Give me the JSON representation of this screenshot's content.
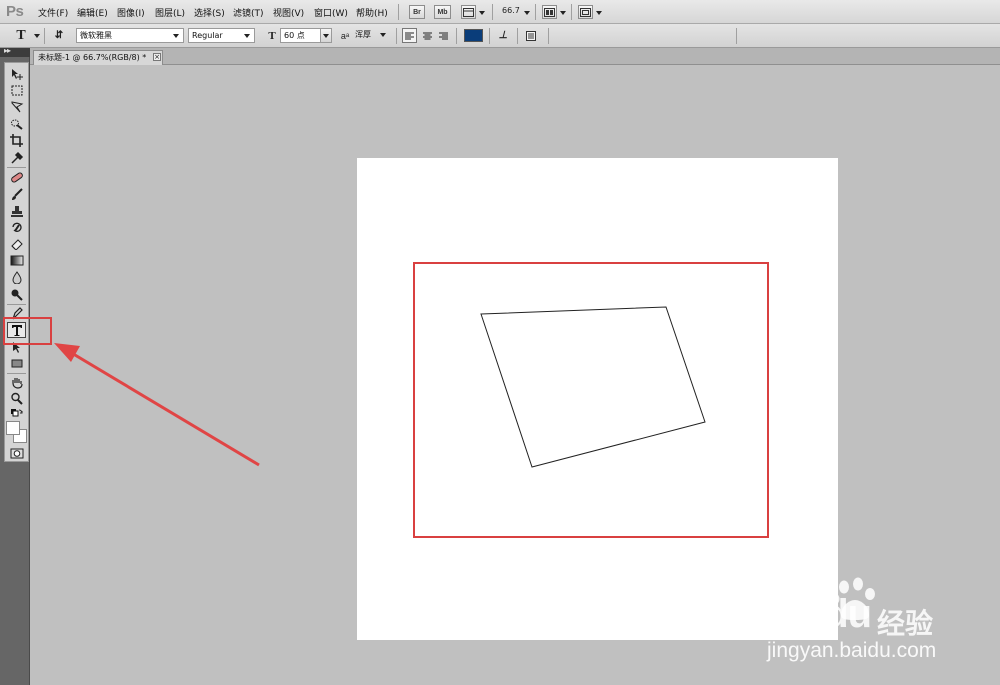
{
  "app": {
    "logo": "Ps"
  },
  "menu": [
    {
      "label": "文件(F)"
    },
    {
      "label": "编辑(E)"
    },
    {
      "label": "图像(I)"
    },
    {
      "label": "图层(L)"
    },
    {
      "label": "选择(S)"
    },
    {
      "label": "滤镜(T)"
    },
    {
      "label": "视图(V)"
    },
    {
      "label": "窗口(W)"
    },
    {
      "label": "帮助(H)"
    }
  ],
  "app_bar": {
    "bridge_label": "Br",
    "minibridge_label": "Mb",
    "zoom": "66.7"
  },
  "options": {
    "font_family": "微软雅黑",
    "font_style": "Regular",
    "font_size": "60 点",
    "aa_label": "a",
    "aa_sub": "a",
    "anti_alias": "浑厚",
    "text_color": "#0a3d7a"
  },
  "document": {
    "tab_title": "未标题-1 @ 66.7%(RGB/8) *",
    "close_label": "×"
  },
  "watermark": {
    "brand": "Baidu",
    "suffix": "经验",
    "url": "jingyan.baidu.com"
  },
  "colors": {
    "highlight": "#d94040",
    "arrow": "#e04545"
  }
}
